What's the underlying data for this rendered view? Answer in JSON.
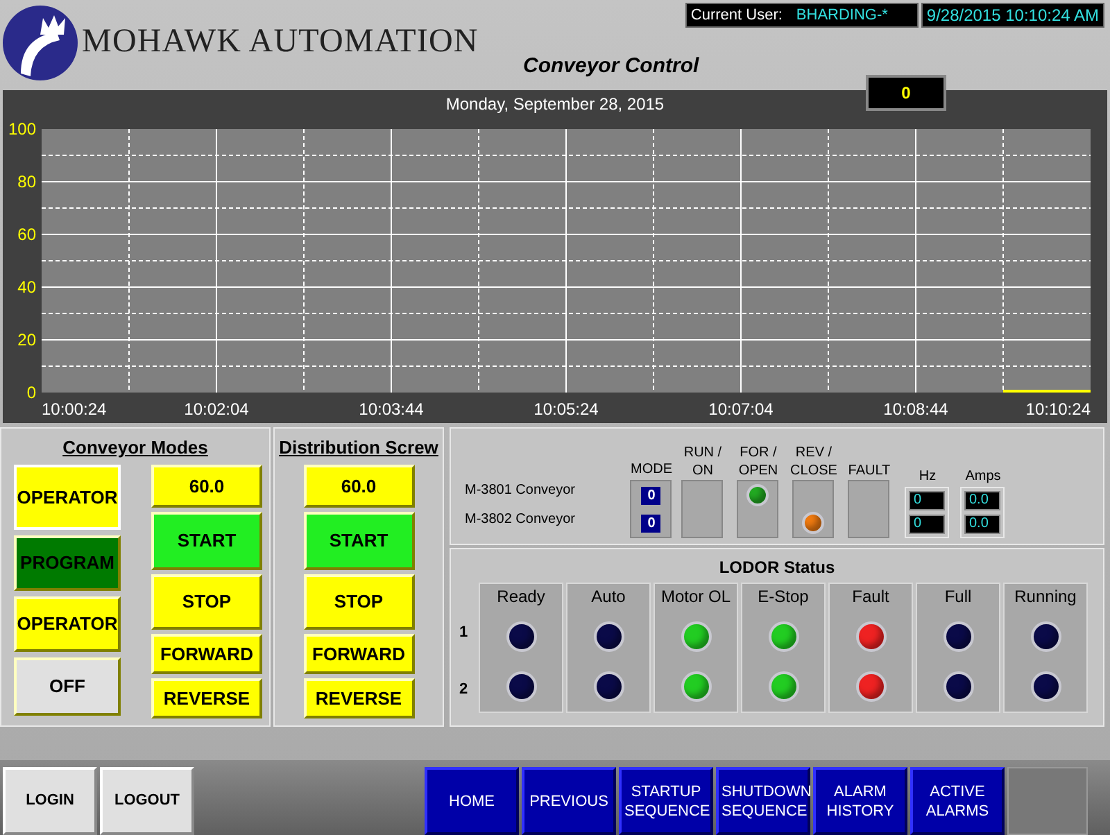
{
  "header": {
    "company": "MOHAWK AUTOMATION",
    "user_label": "Current User:",
    "user": "BHARDING-*",
    "datetime": "9/28/2015 10:10:24 AM",
    "title": "Conveyor Control",
    "counter": "0"
  },
  "trend": {
    "chart_data": {
      "type": "line",
      "title": "Monday, September 28, 2015",
      "ylim": [
        0,
        100
      ],
      "categories": [
        "10:00:24",
        null,
        "10:02:04",
        null,
        "10:03:44",
        null,
        "10:05:24",
        null,
        "10:07:04",
        null,
        "10:08:44",
        null,
        "10:10:24"
      ],
      "yticks": [
        0,
        20,
        40,
        60,
        80,
        100
      ],
      "grid": true,
      "series": [
        {
          "color": "#ffff00",
          "values": [
            null,
            null,
            null,
            null,
            null,
            null,
            null,
            null,
            null,
            null,
            null,
            0,
            0
          ]
        }
      ]
    }
  },
  "conveyor_modes": {
    "title": "Conveyor Modes",
    "modes": [
      {
        "label": "OPERATOR",
        "color": "#ffff00",
        "selected": true
      },
      {
        "label": "PROGRAM",
        "color": "#007a00",
        "selected": false
      },
      {
        "label": "OPERATOR",
        "color": "#ffff00",
        "selected": false
      },
      {
        "label": "OFF",
        "color": "#e0e0e0",
        "selected": false
      }
    ],
    "setpoint": "60.0",
    "buttons": [
      {
        "label": "START",
        "color": "#22ee22"
      },
      {
        "label": "STOP",
        "color": "#ffff00"
      },
      {
        "label": "FORWARD",
        "color": "#ffff00"
      },
      {
        "label": "REVERSE",
        "color": "#ffff00"
      }
    ]
  },
  "distribution_screw": {
    "title": "Distribution Screw",
    "setpoint": "60.0",
    "buttons": [
      {
        "label": "START",
        "color": "#22ee22"
      },
      {
        "label": "STOP",
        "color": "#ffff00"
      },
      {
        "label": "FORWARD",
        "color": "#ffff00"
      },
      {
        "label": "REVERSE",
        "color": "#ffff00"
      }
    ]
  },
  "motors": {
    "rows": [
      "M-3801 Conveyor",
      "M-3802 Conveyor"
    ],
    "mode_header": "MODE",
    "modes": [
      "0",
      "0"
    ],
    "lamp_columns": [
      {
        "header": "RUN / ON",
        "lamps": [
          {
            "on": false
          },
          {
            "on": false
          }
        ]
      },
      {
        "header": "FOR / OPEN",
        "lamps": [
          {
            "on": true,
            "color": "#22aa22"
          },
          {
            "on": false
          }
        ]
      },
      {
        "header": "REV / CLOSE",
        "lamps": [
          {
            "on": false
          },
          {
            "on": true,
            "color": "#f07a10"
          }
        ]
      },
      {
        "header": "FAULT",
        "lamps": [
          {
            "on": false
          },
          {
            "on": false
          }
        ]
      }
    ],
    "hz_header": "Hz",
    "hz": [
      "0",
      "0"
    ],
    "amps_header": "Amps",
    "amps": [
      "0.0",
      "0.0"
    ]
  },
  "lodor": {
    "title": "LODOR Status",
    "row_labels": [
      "1",
      "2"
    ],
    "columns": [
      {
        "label": "Ready",
        "leds": [
          {
            "color": "#0a0a48"
          },
          {
            "color": "#0a0a48"
          }
        ]
      },
      {
        "label": "Auto",
        "leds": [
          {
            "color": "#0a0a48"
          },
          {
            "color": "#0a0a48"
          }
        ]
      },
      {
        "label": "Motor OL",
        "leds": [
          {
            "color": "#22cc22"
          },
          {
            "color": "#22cc22"
          }
        ]
      },
      {
        "label": "E-Stop",
        "leds": [
          {
            "color": "#22cc22"
          },
          {
            "color": "#22cc22"
          }
        ]
      },
      {
        "label": "Fault",
        "leds": [
          {
            "color": "#ee2222"
          },
          {
            "color": "#ee2222"
          }
        ]
      },
      {
        "label": "Full",
        "leds": [
          {
            "color": "#0a0a48"
          },
          {
            "color": "#0a0a48"
          }
        ]
      },
      {
        "label": "Running",
        "leds": [
          {
            "color": "#0a0a48"
          },
          {
            "color": "#0a0a48"
          }
        ]
      }
    ]
  },
  "footer": {
    "account_buttons": [
      "LOGIN",
      "LOGOUT"
    ],
    "nav_buttons": [
      "HOME",
      "PREVIOUS",
      "STARTUP SEQUENCE",
      "SHUTDOWN SEQUENCE",
      "ALARM HISTORY",
      "ACTIVE ALARMS"
    ]
  }
}
